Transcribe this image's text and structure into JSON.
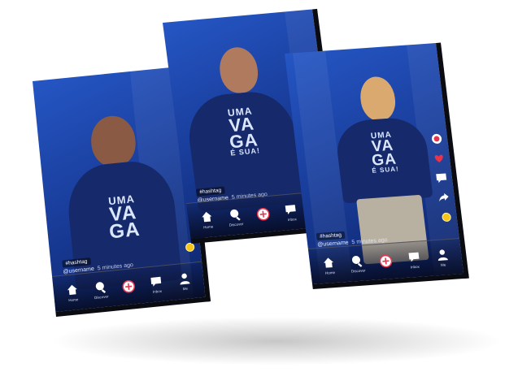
{
  "colors": {
    "bg": "#ffffff",
    "screen_top": "#2556c4",
    "screen_bottom": "#0d246a",
    "like": "#e8344d",
    "coin": "#f5c518"
  },
  "nav": [
    {
      "id": "home",
      "label": "Home",
      "icon": "house-icon"
    },
    {
      "id": "discover",
      "label": "Discover",
      "icon": "search-icon"
    },
    {
      "id": "create",
      "label": "",
      "icon": "plus-circle-icon"
    },
    {
      "id": "inbox",
      "label": "Inbox",
      "icon": "message-icon"
    },
    {
      "id": "me",
      "label": "Me",
      "icon": "person-icon"
    }
  ],
  "phones": [
    {
      "hashtag": "#hashtag",
      "username": "@username",
      "time": "5 minutes ago",
      "shirt": [
        "UMA",
        "VA",
        "GA"
      ]
    },
    {
      "hashtag": "#hashtag",
      "username": "@username",
      "time": "5 minutes ago",
      "shirt": [
        "UMA",
        "VA",
        "GA",
        "É SUA!"
      ]
    },
    {
      "hashtag": "#hashtag",
      "username": "@username",
      "time": "5 minutes ago",
      "shirt": [
        "UMA",
        "VA",
        "GA",
        "É SUA!"
      ]
    }
  ],
  "side_labels": {
    "share": "share",
    "coins": "coin"
  }
}
